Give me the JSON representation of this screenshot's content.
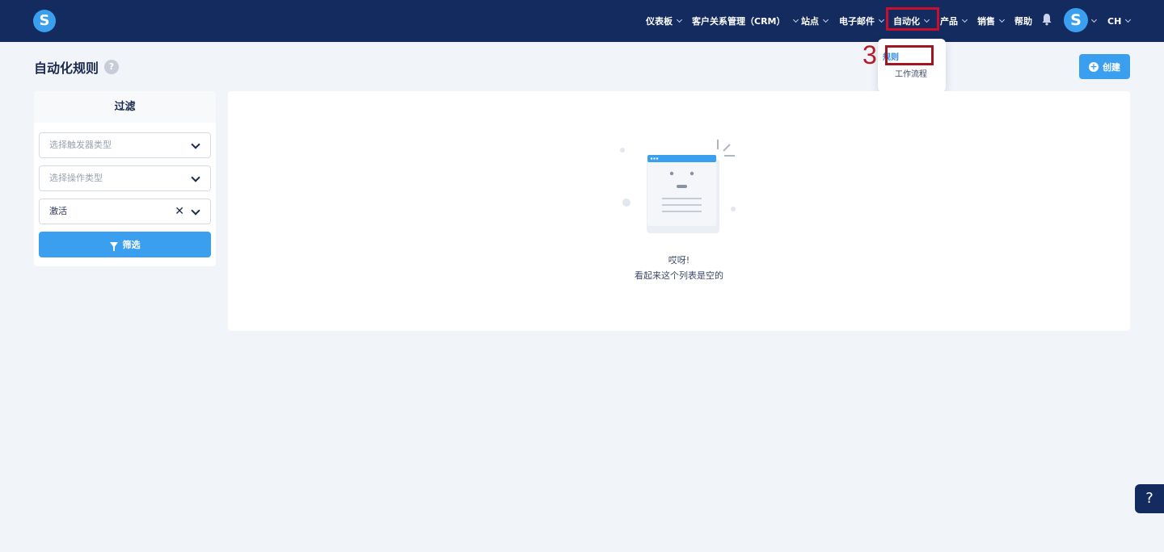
{
  "app": {
    "logo_letter": "S",
    "avatar_letter": "S"
  },
  "nav": {
    "items": [
      {
        "label": "仪表板"
      },
      {
        "label": "客户关系管理（CRM）"
      },
      {
        "label": "站点"
      },
      {
        "label": "电子邮件"
      },
      {
        "label": "自动化"
      },
      {
        "label": "产品"
      },
      {
        "label": "销售"
      },
      {
        "label": "帮助"
      }
    ],
    "language": "CH"
  },
  "dropdown": {
    "items": [
      {
        "label": "规则",
        "active": true
      },
      {
        "label": "工作流程",
        "active": false
      }
    ]
  },
  "annotation": {
    "step_number": "3"
  },
  "page": {
    "title": "自动化规则",
    "help_glyph": "?",
    "create_label": "创建"
  },
  "filter": {
    "header": "过滤",
    "trigger_placeholder": "选择触发器类型",
    "action_placeholder": "选择操作类型",
    "status_value": "激活",
    "button_label": "筛选"
  },
  "empty_state": {
    "title": "哎呀!",
    "subtitle": "看起来这个列表是空的"
  },
  "floating_help": {
    "glyph": "?"
  },
  "colors": {
    "topbar": "#142b5f",
    "accent": "#3b9ff0",
    "highlight": "#c8102e"
  }
}
